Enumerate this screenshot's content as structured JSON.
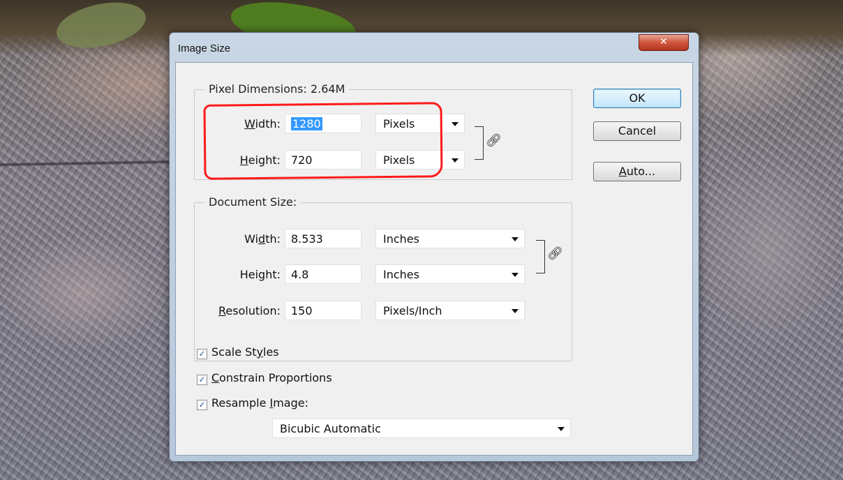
{
  "window": {
    "title": "Image Size",
    "close_glyph": "✕"
  },
  "pixel_dimensions": {
    "legend": "Pixel Dimensions:  2.64M",
    "width_label_pre": "",
    "width_label_u": "W",
    "width_label_post": "idth:",
    "width_value": "1280",
    "width_unit": "Pixels",
    "height_label_u": "H",
    "height_label_post": "eight:",
    "height_value": "720",
    "height_unit": "Pixels"
  },
  "document_size": {
    "legend": "Document Size:",
    "width_label_pre": "Wi",
    "width_label_u": "d",
    "width_label_post": "th:",
    "width_value": "8.533",
    "width_unit": "Inches",
    "height_label_pre": "Hei",
    "height_label_u": "g",
    "height_label_post": "ht:",
    "height_value": "4.8",
    "height_unit": "Inches",
    "resolution_label_u": "R",
    "resolution_label_post": "esolution:",
    "resolution_value": "150",
    "resolution_unit": "Pixels/Inch"
  },
  "buttons": {
    "ok": "OK",
    "cancel": "Cancel",
    "auto_u": "A",
    "auto_post": "uto..."
  },
  "options": {
    "scale_styles_pre": "Scale St",
    "scale_styles_u": "y",
    "scale_styles_post": "les",
    "constrain_u": "C",
    "constrain_post": "onstrain Proportions",
    "resample_pre": "Resample ",
    "resample_u": "I",
    "resample_post": "mage:",
    "resample_method": "Bicubic Automatic",
    "checked_glyph": "✓"
  },
  "icons": {
    "link": "link-chain-icon",
    "dropdown": "dropdown-arrow-icon"
  },
  "colors": {
    "annotation": "#ff1a1a",
    "selection": "#3399ff"
  }
}
